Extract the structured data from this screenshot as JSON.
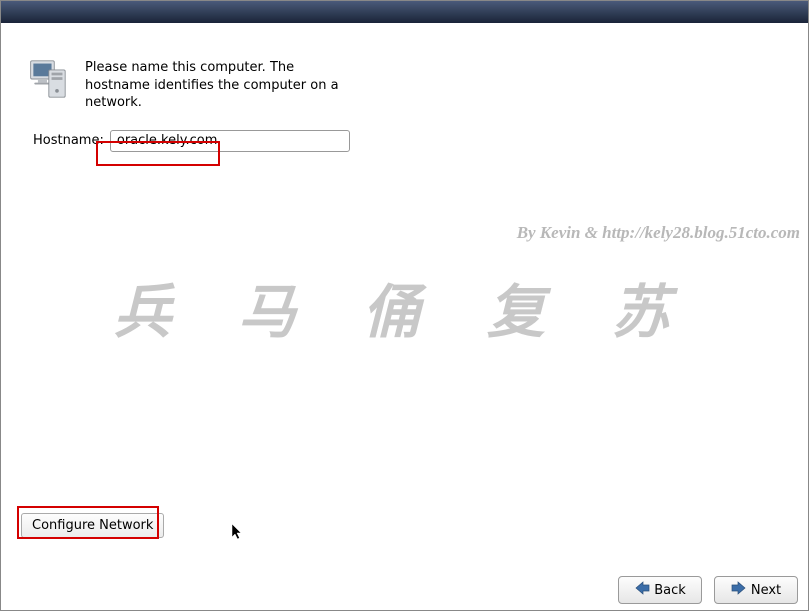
{
  "instruction": "Please name this computer.  The hostname identifies the computer on a network.",
  "hostname": {
    "label": "Hostname:",
    "value": "oracle.kely.com"
  },
  "buttons": {
    "configure": "Configure Network",
    "back": "Back",
    "next": "Next"
  },
  "watermark_cn": "兵 马 俑 复 苏",
  "watermark_en": "By Kevin & http://kely28.blog.51cto.com",
  "icons": {
    "computer": "computer-icon",
    "arrow_left": "arrow-left-icon",
    "arrow_right": "arrow-right-icon"
  }
}
